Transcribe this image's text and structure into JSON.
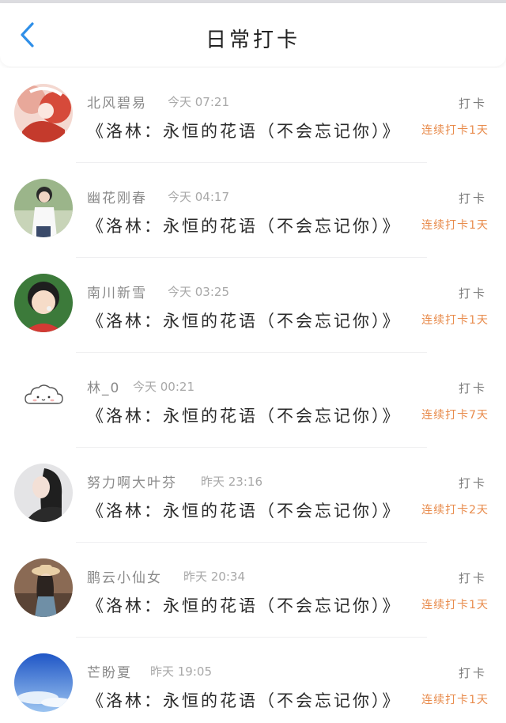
{
  "header": {
    "title": "日常打卡",
    "back_icon": "chevron-left-icon",
    "accent_color": "#2f8fe8"
  },
  "entries": [
    {
      "username": "北风碧易",
      "time": "今天 07:21",
      "book": "《洛林：永恒的花语（不会忘记你）》",
      "checkin_label": "打卡",
      "streak": "连续打卡1天",
      "avatar": "anime-girl-avatar"
    },
    {
      "username": "幽花刚春",
      "time": "今天 04:17",
      "book": "《洛林：永恒的花语（不会忘记你）》",
      "checkin_label": "打卡",
      "streak": "连续打卡1天",
      "avatar": "girl-photo-avatar"
    },
    {
      "username": "南川新雪",
      "time": "今天 03:25",
      "book": "《洛林：永恒的花语（不会忘记你）》",
      "checkin_label": "打卡",
      "streak": "连续打卡1天",
      "avatar": "child-photo-avatar"
    },
    {
      "username": "林_0",
      "time": "今天 00:21",
      "book": "《洛林：永恒的花语（不会忘记你）》",
      "checkin_label": "打卡",
      "streak": "连续打卡7天",
      "avatar": "cloud-cartoon-avatar"
    },
    {
      "username": "努力啊大叶芬",
      "time": "昨天 23:16",
      "book": "《洛林：永恒的花语（不会忘记你）》",
      "checkin_label": "打卡",
      "streak": "连续打卡2天",
      "avatar": "woman-portrait-avatar"
    },
    {
      "username": "鹏云小仙女",
      "time": "昨天 20:34",
      "book": "《洛林：永恒的花语（不会忘记你）》",
      "checkin_label": "打卡",
      "streak": "连续打卡1天",
      "avatar": "hat-girl-avatar"
    },
    {
      "username": "芒盼夏",
      "time": "昨天 19:05",
      "book": "《洛林：永恒的花语（不会忘记你）》",
      "checkin_label": "打卡",
      "streak": "连续打卡1天",
      "avatar": "blue-sky-avatar"
    }
  ]
}
